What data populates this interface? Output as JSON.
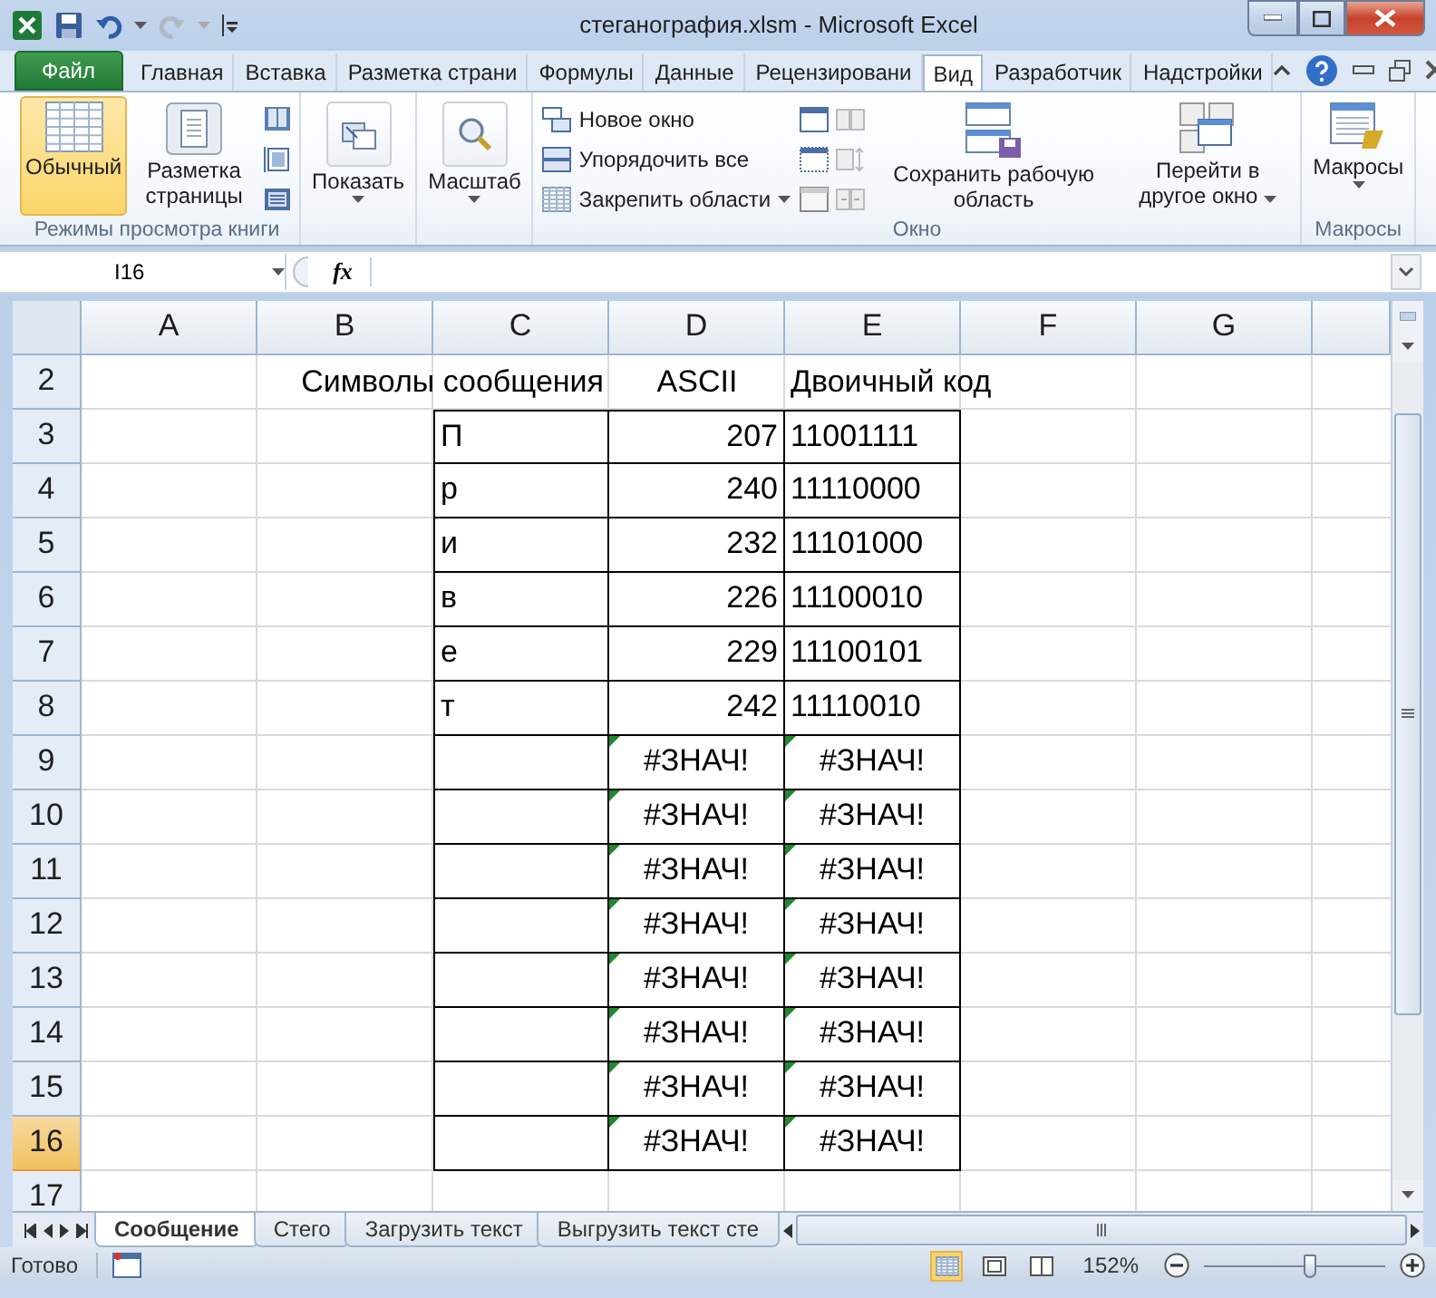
{
  "window": {
    "title": "стеганография.xlsm  -  Microsoft Excel"
  },
  "ribbon": {
    "tabs": [
      {
        "label": "Файл",
        "kind": "file",
        "selected": false
      },
      {
        "label": "Главная",
        "kind": "tab",
        "selected": false
      },
      {
        "label": "Вставка",
        "kind": "tab",
        "selected": false
      },
      {
        "label": "Разметка страни",
        "kind": "tab",
        "selected": false
      },
      {
        "label": "Формулы",
        "kind": "tab",
        "selected": false
      },
      {
        "label": "Данные",
        "kind": "tab",
        "selected": false
      },
      {
        "label": "Рецензировани",
        "kind": "tab",
        "selected": false
      },
      {
        "label": "Вид",
        "kind": "tab",
        "selected": true
      },
      {
        "label": "Разработчик",
        "kind": "tab",
        "selected": false
      },
      {
        "label": "Надстройки",
        "kind": "tab",
        "selected": false
      }
    ],
    "views_group": {
      "label": "Режимы просмотра книги",
      "normal": {
        "label": "Обычный",
        "selected": true
      },
      "page_layout": {
        "label": "Разметка страницы",
        "selected": false
      }
    },
    "show": {
      "label": "Показать"
    },
    "zoom": {
      "label": "Масштаб"
    },
    "window_group": {
      "label": "Окно",
      "new_window": "Новое окно",
      "arrange_all": "Упорядочить все",
      "freeze_panes": "Закрепить области",
      "save_workspace": "Сохранить рабочую область",
      "switch_windows": "Перейти в другое окно"
    },
    "macros_group": {
      "label": "Макросы",
      "macros": "Макросы"
    }
  },
  "formula_bar": {
    "name_box": "I16",
    "function_label": "fx"
  },
  "sheet": {
    "columns": [
      "A",
      "B",
      "C",
      "D",
      "E",
      "F",
      "G"
    ],
    "rows": [
      {
        "header": "2",
        "selected": false,
        "cells": [
          null,
          null,
          {
            "kind": "heading_right",
            "text": "Символы сообщения"
          },
          {
            "kind": "heading_center",
            "text": "ASCII"
          },
          {
            "kind": "heading_left",
            "text": "Двоичный код"
          },
          null,
          null
        ]
      },
      {
        "header": "3",
        "selected": false,
        "cells": [
          null,
          null,
          {
            "kind": "text",
            "text": "П"
          },
          {
            "kind": "number",
            "text": "207"
          },
          {
            "kind": "text",
            "text": "11001111"
          },
          null,
          null
        ]
      },
      {
        "header": "4",
        "selected": false,
        "cells": [
          null,
          null,
          {
            "kind": "text",
            "text": "р"
          },
          {
            "kind": "number",
            "text": "240"
          },
          {
            "kind": "text",
            "text": "11110000"
          },
          null,
          null
        ]
      },
      {
        "header": "5",
        "selected": false,
        "cells": [
          null,
          null,
          {
            "kind": "text",
            "text": "и"
          },
          {
            "kind": "number",
            "text": "232"
          },
          {
            "kind": "text",
            "text": "11101000"
          },
          null,
          null
        ]
      },
      {
        "header": "6",
        "selected": false,
        "cells": [
          null,
          null,
          {
            "kind": "text",
            "text": "в"
          },
          {
            "kind": "number",
            "text": "226"
          },
          {
            "kind": "text",
            "text": "11100010"
          },
          null,
          null
        ]
      },
      {
        "header": "7",
        "selected": false,
        "cells": [
          null,
          null,
          {
            "kind": "text",
            "text": "е"
          },
          {
            "kind": "number",
            "text": "229"
          },
          {
            "kind": "text",
            "text": "11100101"
          },
          null,
          null
        ]
      },
      {
        "header": "8",
        "selected": false,
        "cells": [
          null,
          null,
          {
            "kind": "text",
            "text": "т"
          },
          {
            "kind": "number",
            "text": "242"
          },
          {
            "kind": "text",
            "text": "11110010"
          },
          null,
          null
        ]
      },
      {
        "header": "9",
        "selected": false,
        "cells": [
          null,
          null,
          {
            "kind": "blank"
          },
          {
            "kind": "error",
            "text": "#ЗНАЧ!"
          },
          {
            "kind": "error",
            "text": "#ЗНАЧ!"
          },
          null,
          null
        ]
      },
      {
        "header": "10",
        "selected": false,
        "cells": [
          null,
          null,
          {
            "kind": "blank"
          },
          {
            "kind": "error",
            "text": "#ЗНАЧ!"
          },
          {
            "kind": "error",
            "text": "#ЗНАЧ!"
          },
          null,
          null
        ]
      },
      {
        "header": "11",
        "selected": false,
        "cells": [
          null,
          null,
          {
            "kind": "blank"
          },
          {
            "kind": "error",
            "text": "#ЗНАЧ!"
          },
          {
            "kind": "error",
            "text": "#ЗНАЧ!"
          },
          null,
          null
        ]
      },
      {
        "header": "12",
        "selected": false,
        "cells": [
          null,
          null,
          {
            "kind": "blank"
          },
          {
            "kind": "error",
            "text": "#ЗНАЧ!"
          },
          {
            "kind": "error",
            "text": "#ЗНАЧ!"
          },
          null,
          null
        ]
      },
      {
        "header": "13",
        "selected": false,
        "cells": [
          null,
          null,
          {
            "kind": "blank"
          },
          {
            "kind": "error",
            "text": "#ЗНАЧ!"
          },
          {
            "kind": "error",
            "text": "#ЗНАЧ!"
          },
          null,
          null
        ]
      },
      {
        "header": "14",
        "selected": false,
        "cells": [
          null,
          null,
          {
            "kind": "blank"
          },
          {
            "kind": "error",
            "text": "#ЗНАЧ!"
          },
          {
            "kind": "error",
            "text": "#ЗНАЧ!"
          },
          null,
          null
        ]
      },
      {
        "header": "15",
        "selected": false,
        "cells": [
          null,
          null,
          {
            "kind": "blank"
          },
          {
            "kind": "error",
            "text": "#ЗНАЧ!"
          },
          {
            "kind": "error",
            "text": "#ЗНАЧ!"
          },
          null,
          null
        ]
      },
      {
        "header": "16",
        "selected": true,
        "cells": [
          null,
          null,
          {
            "kind": "blank"
          },
          {
            "kind": "error",
            "text": "#ЗНАЧ!"
          },
          {
            "kind": "error",
            "text": "#ЗНАЧ!"
          },
          null,
          null
        ]
      },
      {
        "header": "17",
        "selected": false,
        "cells": [
          null,
          null,
          null,
          null,
          null,
          null,
          null
        ]
      }
    ]
  },
  "sheet_tabs": [
    {
      "label": "Сообщение",
      "selected": true
    },
    {
      "label": "Стего",
      "selected": false
    },
    {
      "label": "Загрузить текст",
      "selected": false
    },
    {
      "label": "Выгрузить текст сте",
      "selected": false
    }
  ],
  "status_bar": {
    "text": "Готово",
    "view_buttons": [
      {
        "selected": true
      },
      {
        "selected": false
      },
      {
        "selected": false
      }
    ],
    "zoom": "152%",
    "zoom_slider": {
      "level": 0.59
    }
  }
}
